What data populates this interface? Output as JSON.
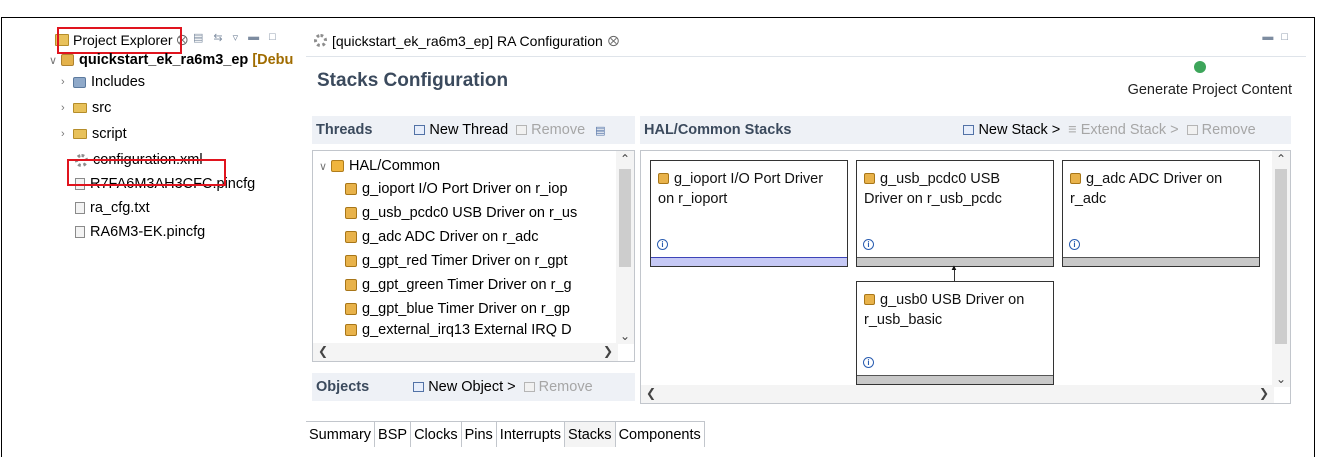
{
  "project_explorer": {
    "title": "Project Explorer",
    "close_glyph": "⨂",
    "toolbar_icons": [
      "collapse-all-icon",
      "link-with-editor-icon",
      "view-menu-icon",
      "minimize-icon",
      "maximize-icon"
    ],
    "tree": {
      "project": {
        "name": "quickstart_ek_ra6m3_ep",
        "suffix": "[Debu"
      },
      "items": [
        {
          "label": "Includes",
          "icon": "includes-icon"
        },
        {
          "label": "src",
          "icon": "source-folder-icon"
        },
        {
          "label": "script",
          "icon": "folder-icon"
        },
        {
          "label": "configuration.xml",
          "icon": "configuration-icon"
        },
        {
          "label": "R7FA6M3AH3CFC.pincfg",
          "icon": "file-icon"
        },
        {
          "label": "ra_cfg.txt",
          "icon": "file-icon"
        },
        {
          "label": "RA6M3-EK.pincfg",
          "icon": "file-icon"
        }
      ]
    },
    "highlight_color": "#e0141e"
  },
  "editor": {
    "tab_title": "[quickstart_ek_ra6m3_ep] RA Configuration",
    "close_glyph": "⨂",
    "page_title": "Stacks Configuration",
    "generate_label": "Generate Project Content",
    "threads": {
      "title": "Threads",
      "new_thread": "New Thread",
      "remove": "Remove",
      "root": "HAL/Common",
      "items": [
        "g_ioport I/O Port Driver on r_iop",
        "g_usb_pcdc0 USB Driver on r_us",
        "g_adc ADC Driver on r_adc",
        "g_gpt_red Timer Driver on r_gpt",
        "g_gpt_green Timer Driver on r_g",
        "g_gpt_blue Timer Driver on r_gp",
        "g_external_irq13 External IRQ D"
      ]
    },
    "objects": {
      "title": "Objects",
      "new_object": "New Object >",
      "remove": "Remove"
    },
    "hal_stacks": {
      "title": "HAL/Common Stacks",
      "new_stack": "New Stack >",
      "extend_stack": "Extend Stack >",
      "remove": "Remove",
      "modules": [
        {
          "line1": "g_ioport I/O Port Driver",
          "line2": "on r_ioport",
          "selected": true
        },
        {
          "line1": "g_usb_pcdc0 USB",
          "line2": "Driver on r_usb_pcdc",
          "selected": false
        },
        {
          "line1": "g_adc ADC Driver on",
          "line2": "r_adc",
          "selected": false
        },
        {
          "line1": "g_usb0 USB Driver on",
          "line2": "r_usb_basic",
          "selected": false
        }
      ]
    },
    "bottom_tabs": [
      "Summary",
      "BSP",
      "Clocks",
      "Pins",
      "Interrupts",
      "Stacks",
      "Components"
    ],
    "active_bottom_tab": "Stacks",
    "accent_color": "#3b4a5d",
    "selection_color": "#c6c9f5"
  }
}
